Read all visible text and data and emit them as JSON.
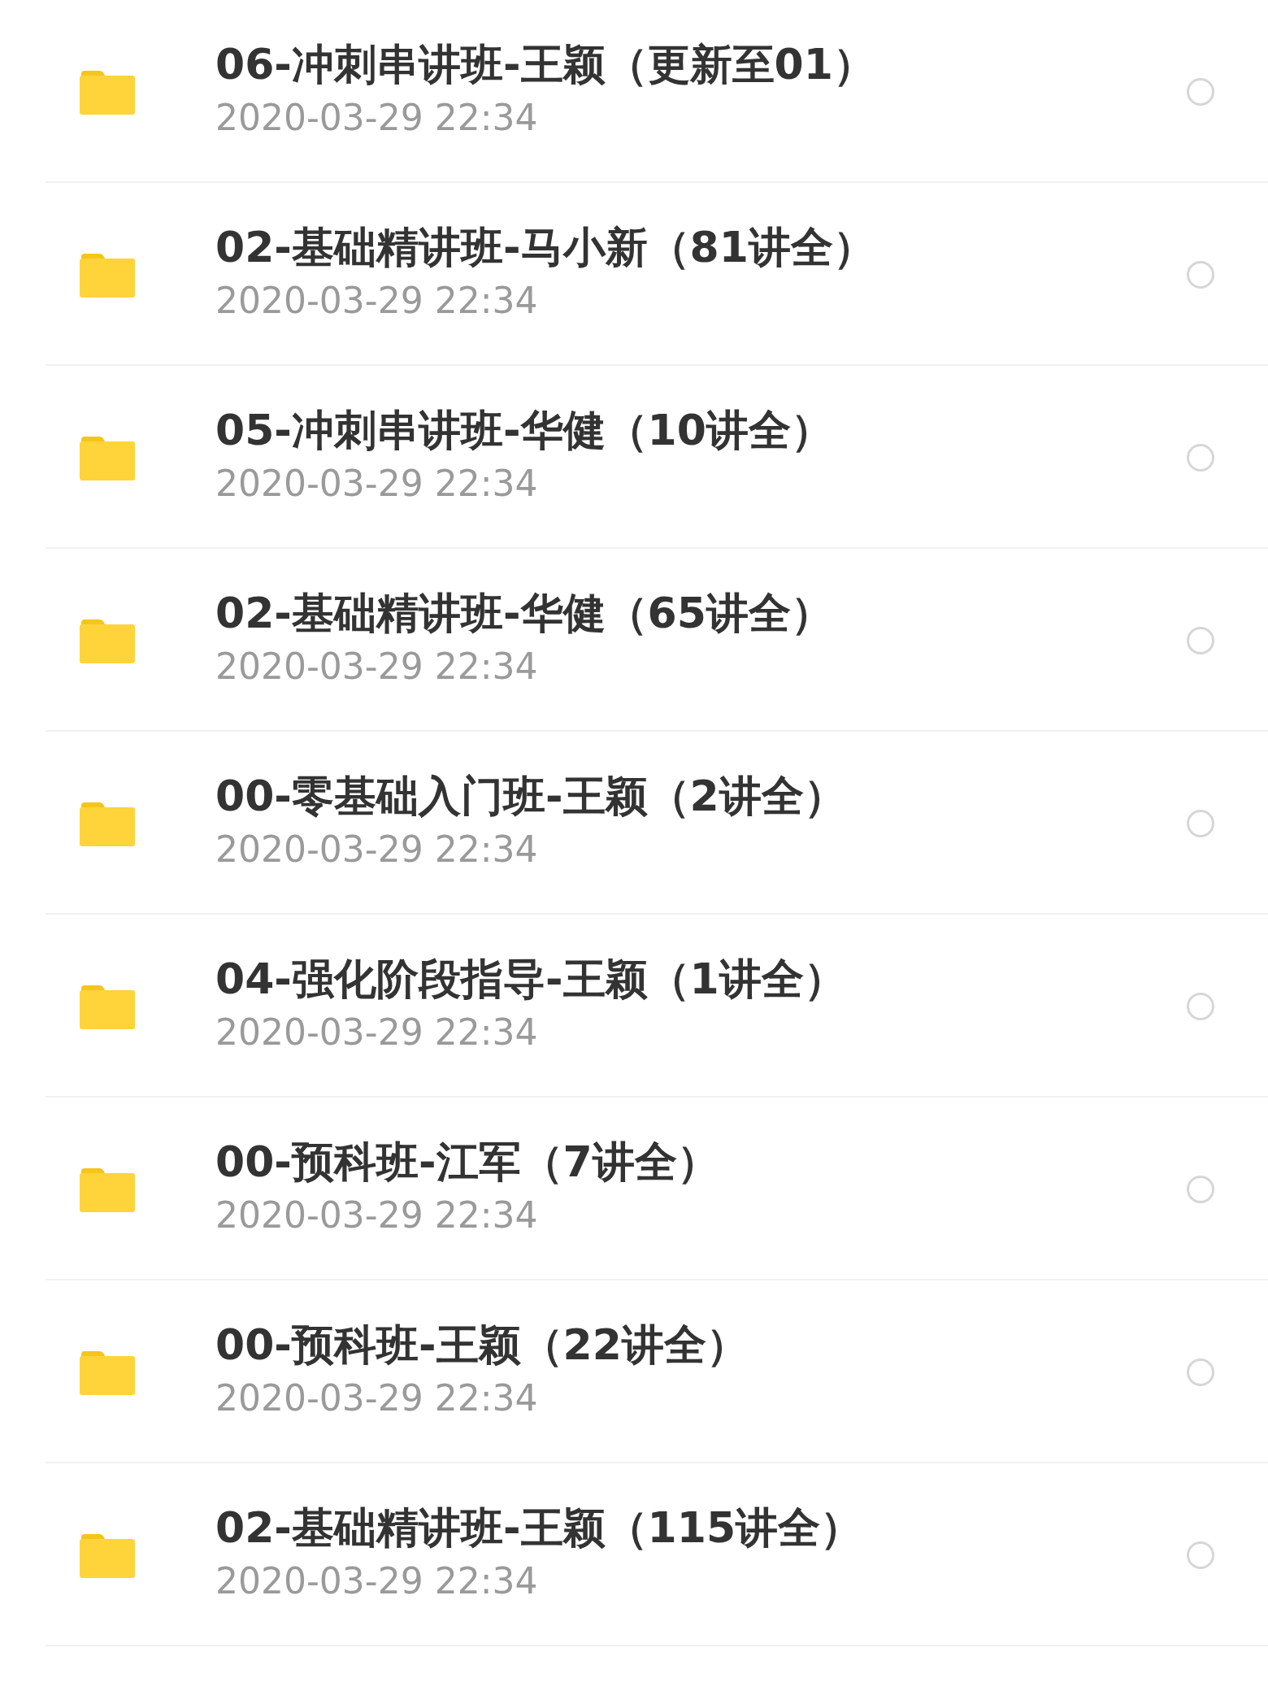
{
  "files": [
    {
      "name": "06-冲刺串讲班-王颖（更新至01）",
      "date": "2020-03-29 22:34",
      "selected": false
    },
    {
      "name": "02-基础精讲班-马小新（81讲全）",
      "date": "2020-03-29 22:34",
      "selected": false
    },
    {
      "name": "05-冲刺串讲班-华健（10讲全）",
      "date": "2020-03-29 22:34",
      "selected": false
    },
    {
      "name": "02-基础精讲班-华健（65讲全）",
      "date": "2020-03-29 22:34",
      "selected": false
    },
    {
      "name": "00-零基础入门班-王颖（2讲全）",
      "date": "2020-03-29 22:34",
      "selected": false
    },
    {
      "name": "04-强化阶段指导-王颖（1讲全）",
      "date": "2020-03-29 22:34",
      "selected": false
    },
    {
      "name": "00-预科班-江军（7讲全）",
      "date": "2020-03-29 22:34",
      "selected": false
    },
    {
      "name": "00-预科班-王颖（22讲全）",
      "date": "2020-03-29 22:34",
      "selected": false
    },
    {
      "name": "02-基础精讲班-王颖（115讲全）",
      "date": "2020-03-29 22:34",
      "selected": false
    }
  ]
}
